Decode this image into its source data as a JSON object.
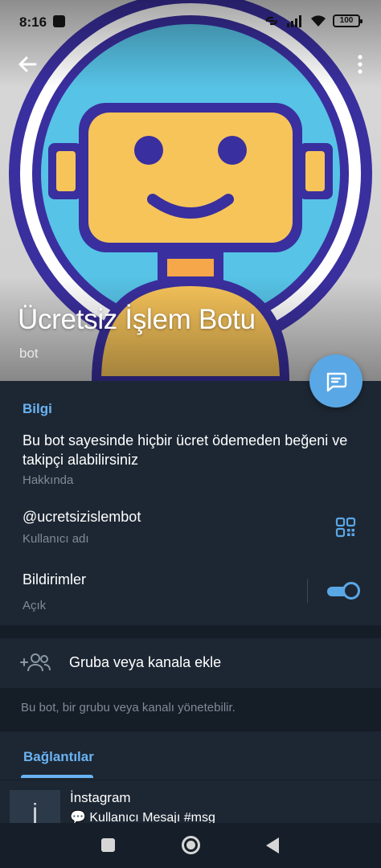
{
  "status_bar": {
    "time": "8:16",
    "battery": "100"
  },
  "profile": {
    "name": "Ücretsiz İşlem Botu",
    "subtitle": "bot"
  },
  "info": {
    "section_title": "Bilgi",
    "about_text": "Bu bot sayesinde hiçbir ücret ödemeden beğeni ve takipçi alabilirsiniz",
    "about_label": "Hakkında",
    "username": "@ucretsizislembot",
    "username_label": "Kullanıcı adı",
    "notifications_title": "Bildirimler",
    "notifications_status": "Açık",
    "notifications_enabled": true
  },
  "actions": {
    "add_to_group": "Gruba veya kanala ekle",
    "add_hint": "Bu bot, bir grubu veya kanalı yönetebilir."
  },
  "tabs": {
    "links": "Bağlantılar"
  },
  "link_item": {
    "thumb_char": "İ",
    "title": "İnstagram",
    "message": "💬 Kullanıcı Mesajı #msg"
  },
  "icons": [
    "back-arrow-icon",
    "more-vertical-icon",
    "message-icon",
    "qr-code-icon",
    "add-members-icon"
  ],
  "colors": {
    "accent": "#6ab3f3",
    "fab": "#5aa7e6",
    "background": "#1d2733",
    "section_gap": "#151d27",
    "robot_face": "#f7c45a",
    "robot_ring": "#3a2f9e",
    "robot_bg": "#57c3e6"
  }
}
